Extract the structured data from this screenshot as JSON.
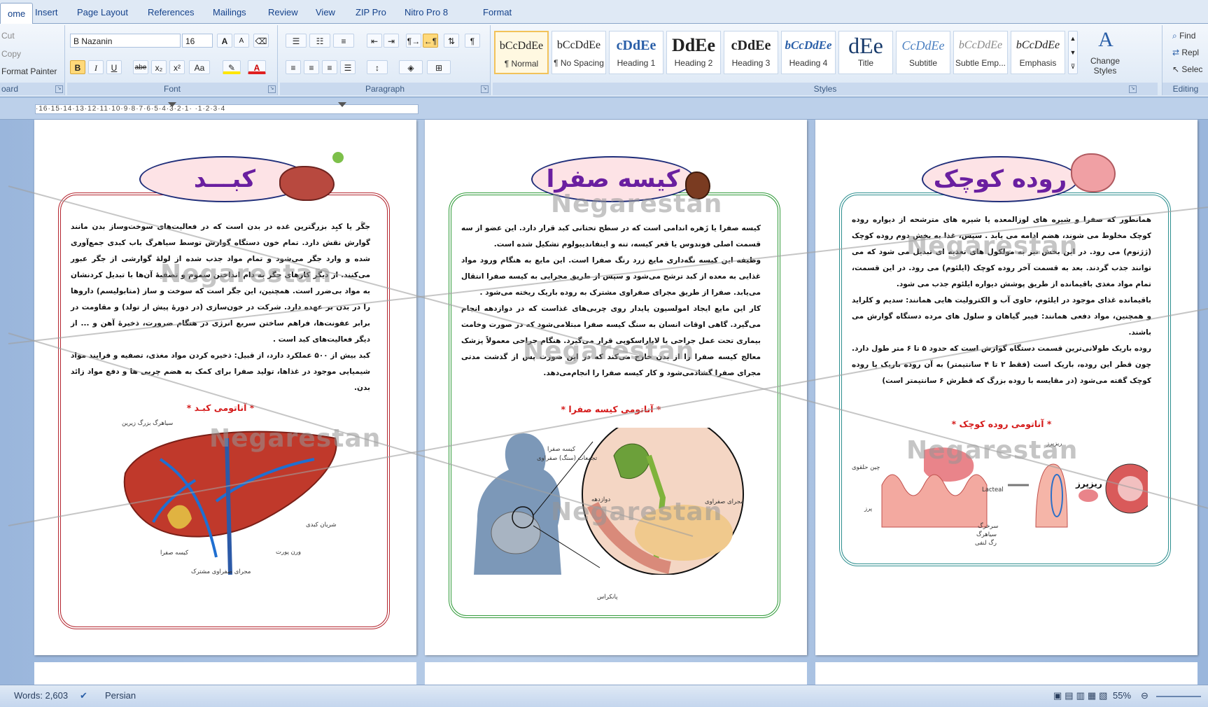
{
  "tabs": [
    "ome",
    "Insert",
    "Page Layout",
    "References",
    "Mailings",
    "Review",
    "View",
    "ZIP Pro",
    "Nitro Pro 8",
    "Format"
  ],
  "clipboard": {
    "cut": "Cut",
    "copy": "Copy",
    "format_painter": "Format Painter",
    "label": "oard"
  },
  "font": {
    "name": "B Nazanin",
    "size": "16",
    "label": "Font",
    "bold": "B",
    "italic": "I",
    "underline": "U",
    "strike": "abe",
    "sub": "x₂",
    "sup": "x²",
    "case": "Aa",
    "grow": "A",
    "shrink": "A"
  },
  "paragraph": {
    "label": "Paragraph"
  },
  "styles": {
    "label": "Styles",
    "items": [
      {
        "preview": "‏bCcDdEe",
        "name": "¶ Normal"
      },
      {
        "preview": "‏bCcDdEe",
        "name": "¶ No Spacing"
      },
      {
        "preview": "cDdEe",
        "name": "Heading 1"
      },
      {
        "preview": "DdEe",
        "name": "Heading 2"
      },
      {
        "preview": "cDdEe",
        "name": "Heading 3"
      },
      {
        "preview": "bCcDdEe",
        "name": "Heading 4"
      },
      {
        "preview": "dEe",
        "name": "Title"
      },
      {
        "preview": "CcDdEe",
        "name": "Subtitle"
      },
      {
        "preview": "bCcDdEe",
        "name": "Subtle Emp..."
      },
      {
        "preview": "bCcDdEe",
        "name": "Emphasis"
      }
    ],
    "change_styles": "Change Styles"
  },
  "editing": {
    "label": "Editing",
    "find": "Find",
    "replace": "Repl",
    "select": "Selec"
  },
  "ruler": {
    "ticks": "·16·15·14·13·12·11·10·9·8·7·6·5·4·3·2·1·  ·1·2·3·4"
  },
  "watermark": "Negarestan",
  "pages": [
    {
      "title": "کبـــد",
      "paragraphs": [
        "جگَر یا کبِد بزرگترین غده در بدن است  که در فعالیت‌های سوخت‌وساز بدن مانند گوارش نقش دارد. تمام خون دستگاه گوارش توسط سیاهرگ باب کبدی جمع‌آوری شده و وارد جگر می‌شود و تمام مواد جذب شده از لولهٔ گوارشی از جگر عبور می‌کنند. از دیگر کارهای جگر به دام انداختن سموم و تصفیهٔ آن‌ها با تبدیل کردنشان به مواد بی‌ضرر است. همچنین، این جگر است که سوخت و ساز (متابولیسم) داروها را در بدن بر عهده دارد. شرکت در خون‌سازی (در دورهٔ پیش از تولد) و مقاومت در برابر عفونت‌ها، فراهم ساختن سریع انرژی در هنگام ضرورت، ذخیرهٔ آهن و ... از دیگر فعالیت‌های کبد است .",
        "کبد بیش از ۵۰۰ عملکرد دارد، از قبیل: ذخیره کردن مواد مغذی، تصفیه و فرایند مواد شیمیایی موجود در غذاها، تولید صفرا برای کمک به هضم چربی ها و دفع مواد زائد بدن."
      ],
      "anatomy_title": "* آناتومی کبـد *",
      "labels": [
        "سیاهرگ بزرگ زیرین",
        "شریان کبدی",
        "ورن پورت",
        "کیسه صفرا",
        "مجرای صفراوی مشترک"
      ]
    },
    {
      "title": "کیسه صفرا",
      "paragraphs": [
        "کیسه صفرا یا زَهره اندامی است که در سطح تحتانی کبد قرار دارد. این عضو از سه قسمت اصلی فوندوس یا قعر کیسه، تنه و اینفاندیبولوم تشکیل شده است.",
        "وظیفه این کیسه نگه‌داری مایع زرد رنگ صفرا است. این مایع به هنگام ورود مواد غذایی به معده از کبد ترشح می‌شود و سپس از طریق مجرایی به کیسه صفرا انتقال می‌یابد. صفرا از طریق مجرای صفراوی مشترک به روده باریک ریخته می‌شود .",
        "کار این مایع ایجاد امولسیون پایدار روی چربی‌های غذاست که در دوازدهه انجام می‌گیرد. گاهی اوقات انسان به سنگ کیسه صفرا مبتلا‌می‌شود که در صورت وخامت بیماری تحت عمل جراحی یا لاپاراسکوپی قرار می‌گیرد. هنگام جراحی معمولاً پزشک معالج کیسه صفرا را از بدن خارج می‌کند که در این صورت پس از گذشت مدتی مجرای صفرا گشاد‌می‌شود و کار کیسه صفرا را انجام‌می‌دهد."
      ],
      "anatomy_title": "* آناتومی کیسه صفرا *",
      "labels": [
        "کیسه صفرا",
        "تجمعات (سنگ) صفراوی",
        "دوازدهه",
        "مجرای صفراوی",
        "پانکراس"
      ]
    },
    {
      "title": "روده کوچک",
      "paragraphs": [
        "همانطور که صفرا و شیره های لوزالمعده یا شیره های مترشحه از دیواره روده کوچک مخلوط می شوند، هضم ادامه می یابد . سپس، غذا به بخش دوم روده کوچک (ژژنوم) می رود. در این بخش نیز به مولکول های تغذیه ای تبدیل می شود که می توانند جذب گردند. بعد به قسمت آخر روده کوچک (ایلئوم) می رود. در این قسمت، تمام مواد مغذی باقیمانده از طریق پوشش دیواره ایلئوم جذب می شود.",
        "باقیمانده غذای موجود در ایلئوم، حاوی آب و الکترولیت هایی همانند: سدیم و کلراید و همچنین، مواد دفعی همانند: فیبر گیاهان و سلول های مرده دستگاه گوارش می باشند.",
        "روده باریک طولانی‌ترین قسمت دستگاه گوارش است که حدود ۵ تا ۶ متر طول دارد. چون قطر این روده، باریک است (فقط ۲ تا ۴ سانتیمتر) به آن روده باریک یا روده کوچک گفته می‌شود (در مقایسه با روده بزرگ که قطرش ۶ سانتیمتر است)"
      ],
      "anatomy_title": "* آناتومی روده کوچک *",
      "labels": [
        "ریزپرز",
        "چین حلقوی",
        "پرز",
        "Lacteal",
        "سرخرگ",
        "سیاهرگ",
        "رگ لنفی"
      ]
    }
  ],
  "status": {
    "words": "Words: 2,603",
    "language": "Persian",
    "zoom": "55%"
  },
  "colors": {
    "title_purple": "#6a1fa0",
    "anatomy_red": "#d51a1a",
    "frame_red": "#b4262f",
    "frame_green": "#2f9a38",
    "frame_teal": "#2d8f8f"
  }
}
